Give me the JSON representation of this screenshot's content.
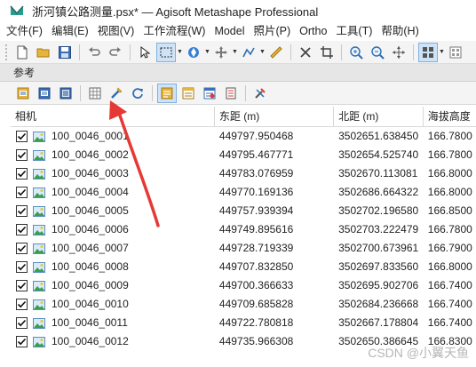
{
  "window": {
    "title": "浙河镇公路测量.psx* — Agisoft Metashape Professional"
  },
  "menu": {
    "items": [
      {
        "label": "文件(F)"
      },
      {
        "label": "编辑(E)"
      },
      {
        "label": "视图(V)"
      },
      {
        "label": "工作流程(W)"
      },
      {
        "label": "Model"
      },
      {
        "label": "照片(P)"
      },
      {
        "label": "Ortho"
      },
      {
        "label": "工具(T)"
      },
      {
        "label": "帮助(H)"
      }
    ]
  },
  "toolbar": {
    "icons": [
      "new-file-icon",
      "open-folder-icon",
      "save-icon",
      "undo-icon",
      "redo-icon",
      "pointer-icon",
      "rect-select-icon",
      "navigation-icon",
      "move-icon",
      "draw-polyline-icon",
      "ruler-icon",
      "delete-icon",
      "crop-icon",
      "zoom-in-icon",
      "zoom-out-icon",
      "reset-view-icon",
      "grid-view-icon"
    ]
  },
  "panel": {
    "title": "参考"
  },
  "reference_toolbar": {
    "icons": [
      "import-reference-icon",
      "export-reference-icon",
      "convert-reference-icon",
      "calculator-icon",
      "settings-wrench-icon",
      "update-icon",
      "view-source-icon",
      "view-error-icon",
      "view-estimated-icon",
      "view-variance-icon",
      "tools-icon"
    ]
  },
  "table": {
    "headers": {
      "camera": "相机",
      "east": "东距 (m)",
      "north": "北距 (m)",
      "alt": "海拔高度"
    },
    "rows": [
      {
        "name": "100_0046_0001",
        "east": "449797.950468",
        "north": "3502651.638450",
        "alt": "166.7800"
      },
      {
        "name": "100_0046_0002",
        "east": "449795.467771",
        "north": "3502654.525740",
        "alt": "166.7800"
      },
      {
        "name": "100_0046_0003",
        "east": "449783.076959",
        "north": "3502670.113081",
        "alt": "166.8000"
      },
      {
        "name": "100_0046_0004",
        "east": "449770.169136",
        "north": "3502686.664322",
        "alt": "166.8000"
      },
      {
        "name": "100_0046_0005",
        "east": "449757.939394",
        "north": "3502702.196580",
        "alt": "166.8500"
      },
      {
        "name": "100_0046_0006",
        "east": "449749.895616",
        "north": "3502703.222479",
        "alt": "166.7800"
      },
      {
        "name": "100_0046_0007",
        "east": "449728.719339",
        "north": "3502700.673961",
        "alt": "166.7900"
      },
      {
        "name": "100_0046_0008",
        "east": "449707.832850",
        "north": "3502697.833560",
        "alt": "166.8000"
      },
      {
        "name": "100_0046_0009",
        "east": "449700.366633",
        "north": "3502695.902706",
        "alt": "166.7400"
      },
      {
        "name": "100_0046_0010",
        "east": "449709.685828",
        "north": "3502684.236668",
        "alt": "166.7400"
      },
      {
        "name": "100_0046_0011",
        "east": "449722.780818",
        "north": "3502667.178804",
        "alt": "166.7400"
      },
      {
        "name": "100_0046_0012",
        "east": "449735.966308",
        "north": "3502650.386645",
        "alt": "166.8300"
      }
    ]
  },
  "watermark": {
    "text": "CSDN @小翼天鱼"
  },
  "colors": {
    "accent": "#e53935",
    "folder": "#e8b33a",
    "link": "#2d6db5"
  }
}
